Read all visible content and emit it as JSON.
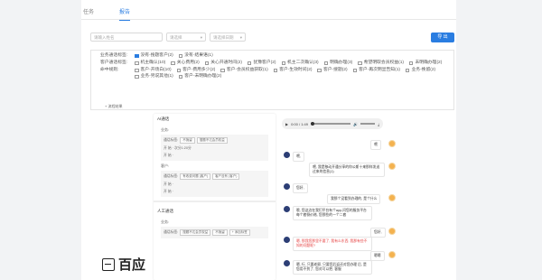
{
  "tabs": [
    {
      "label": "任务"
    },
    {
      "label": "报告"
    }
  ],
  "filters": {
    "search_placeholder": "请输入姓名",
    "select1": "请选择",
    "select2": "请选择日期",
    "export_label": "导 出"
  },
  "tag_groups": [
    {
      "label": "业务通话标签:",
      "options": [
        {
          "text": "没有-搜题客户(2)",
          "checked": true
        },
        {
          "text": "没有-结果语(1)",
          "checked": false
        }
      ]
    },
    {
      "label": "客户通话标签:",
      "options": [
        {
          "text": "机主确认(10)",
          "checked": false
        },
        {
          "text": "关心费用(2)",
          "checked": false
        },
        {
          "text": "关心开通时间(2)",
          "checked": false
        },
        {
          "text": "犹豫客户(2)",
          "checked": false
        },
        {
          "text": "机主二次确认(3)",
          "checked": false
        },
        {
          "text": "明确办理(3)",
          "checked": false
        },
        {
          "text": "希望明取会员权益(1)",
          "checked": false
        },
        {
          "text": "未明确办理(2)",
          "checked": false
        }
      ]
    },
    {
      "label": "命中规则:",
      "options": [
        {
          "text": "客户-开场白(10)",
          "checked": false
        },
        {
          "text": "客户-费用多少(2)",
          "checked": false
        },
        {
          "text": "客户-会员权益获取(1)",
          "checked": false
        },
        {
          "text": "客户-生效时间(2)",
          "checked": false
        },
        {
          "text": "客户-搜题(2)",
          "checked": false
        },
        {
          "text": "客户-再次明显告知(1)",
          "checked": false
        },
        {
          "text": "业务-挽留(2)",
          "checked": false
        },
        {
          "text": "业务-另说其他(1)",
          "checked": false
        },
        {
          "text": "客户-未明确办理(2)",
          "checked": false
        }
      ]
    }
  ],
  "flow_link": "+ 流程结果",
  "left_panel": {
    "section1": "AI通话",
    "business_label": "业务:",
    "tag_label": "通话标签:",
    "tag_values": [
      "不挽留",
      "搜题不达会员权益"
    ],
    "line1": "开 始 · 次分1:20分",
    "line2": "开 始 ·",
    "customer_label": "客户:",
    "cust_tags": [
      "有收费问题 (客户)",
      "客户没有 (客户)"
    ],
    "line3": "开 始 ·",
    "line4": "开 始 ·",
    "section2": "人工通话",
    "business_label2": "业务:",
    "tag_label2": "通话标签:",
    "tag_values2": [
      "搜题不达会员权益",
      "不挽留",
      "+ 添加标签"
    ]
  },
  "audio": {
    "time": "0:00 / 1:49"
  },
  "chat": [
    {
      "side": "user",
      "text": "喂"
    },
    {
      "side": "bot",
      "text": "喂,"
    },
    {
      "side": "user",
      "text": "喂, 我是移动开通分享的你公斯十来那样发送过来的信息(1)"
    },
    {
      "side": "bot",
      "text": "您好,"
    },
    {
      "side": "user",
      "text": "我那个没看到办理的, 是个什么"
    },
    {
      "side": "bot",
      "text": "哦, 您这边在我们平台有个app,问您的服务平台每个套餐价格, 您那些的一个二套"
    },
    {
      "side": "user",
      "text": "您好,"
    },
    {
      "side": "bot",
      "text": "嗯, 那我您那里不要了, 我有么东西; 我那有些不知的问题呢?"
    },
    {
      "side": "user",
      "text": "嗯嗯"
    },
    {
      "side": "bot",
      "text": "嗯, 行, 只要老顾, 只要您后返还对您办理 后, 是您用不到了, 您对可以把, 客服"
    }
  ],
  "logo_text": "百应"
}
